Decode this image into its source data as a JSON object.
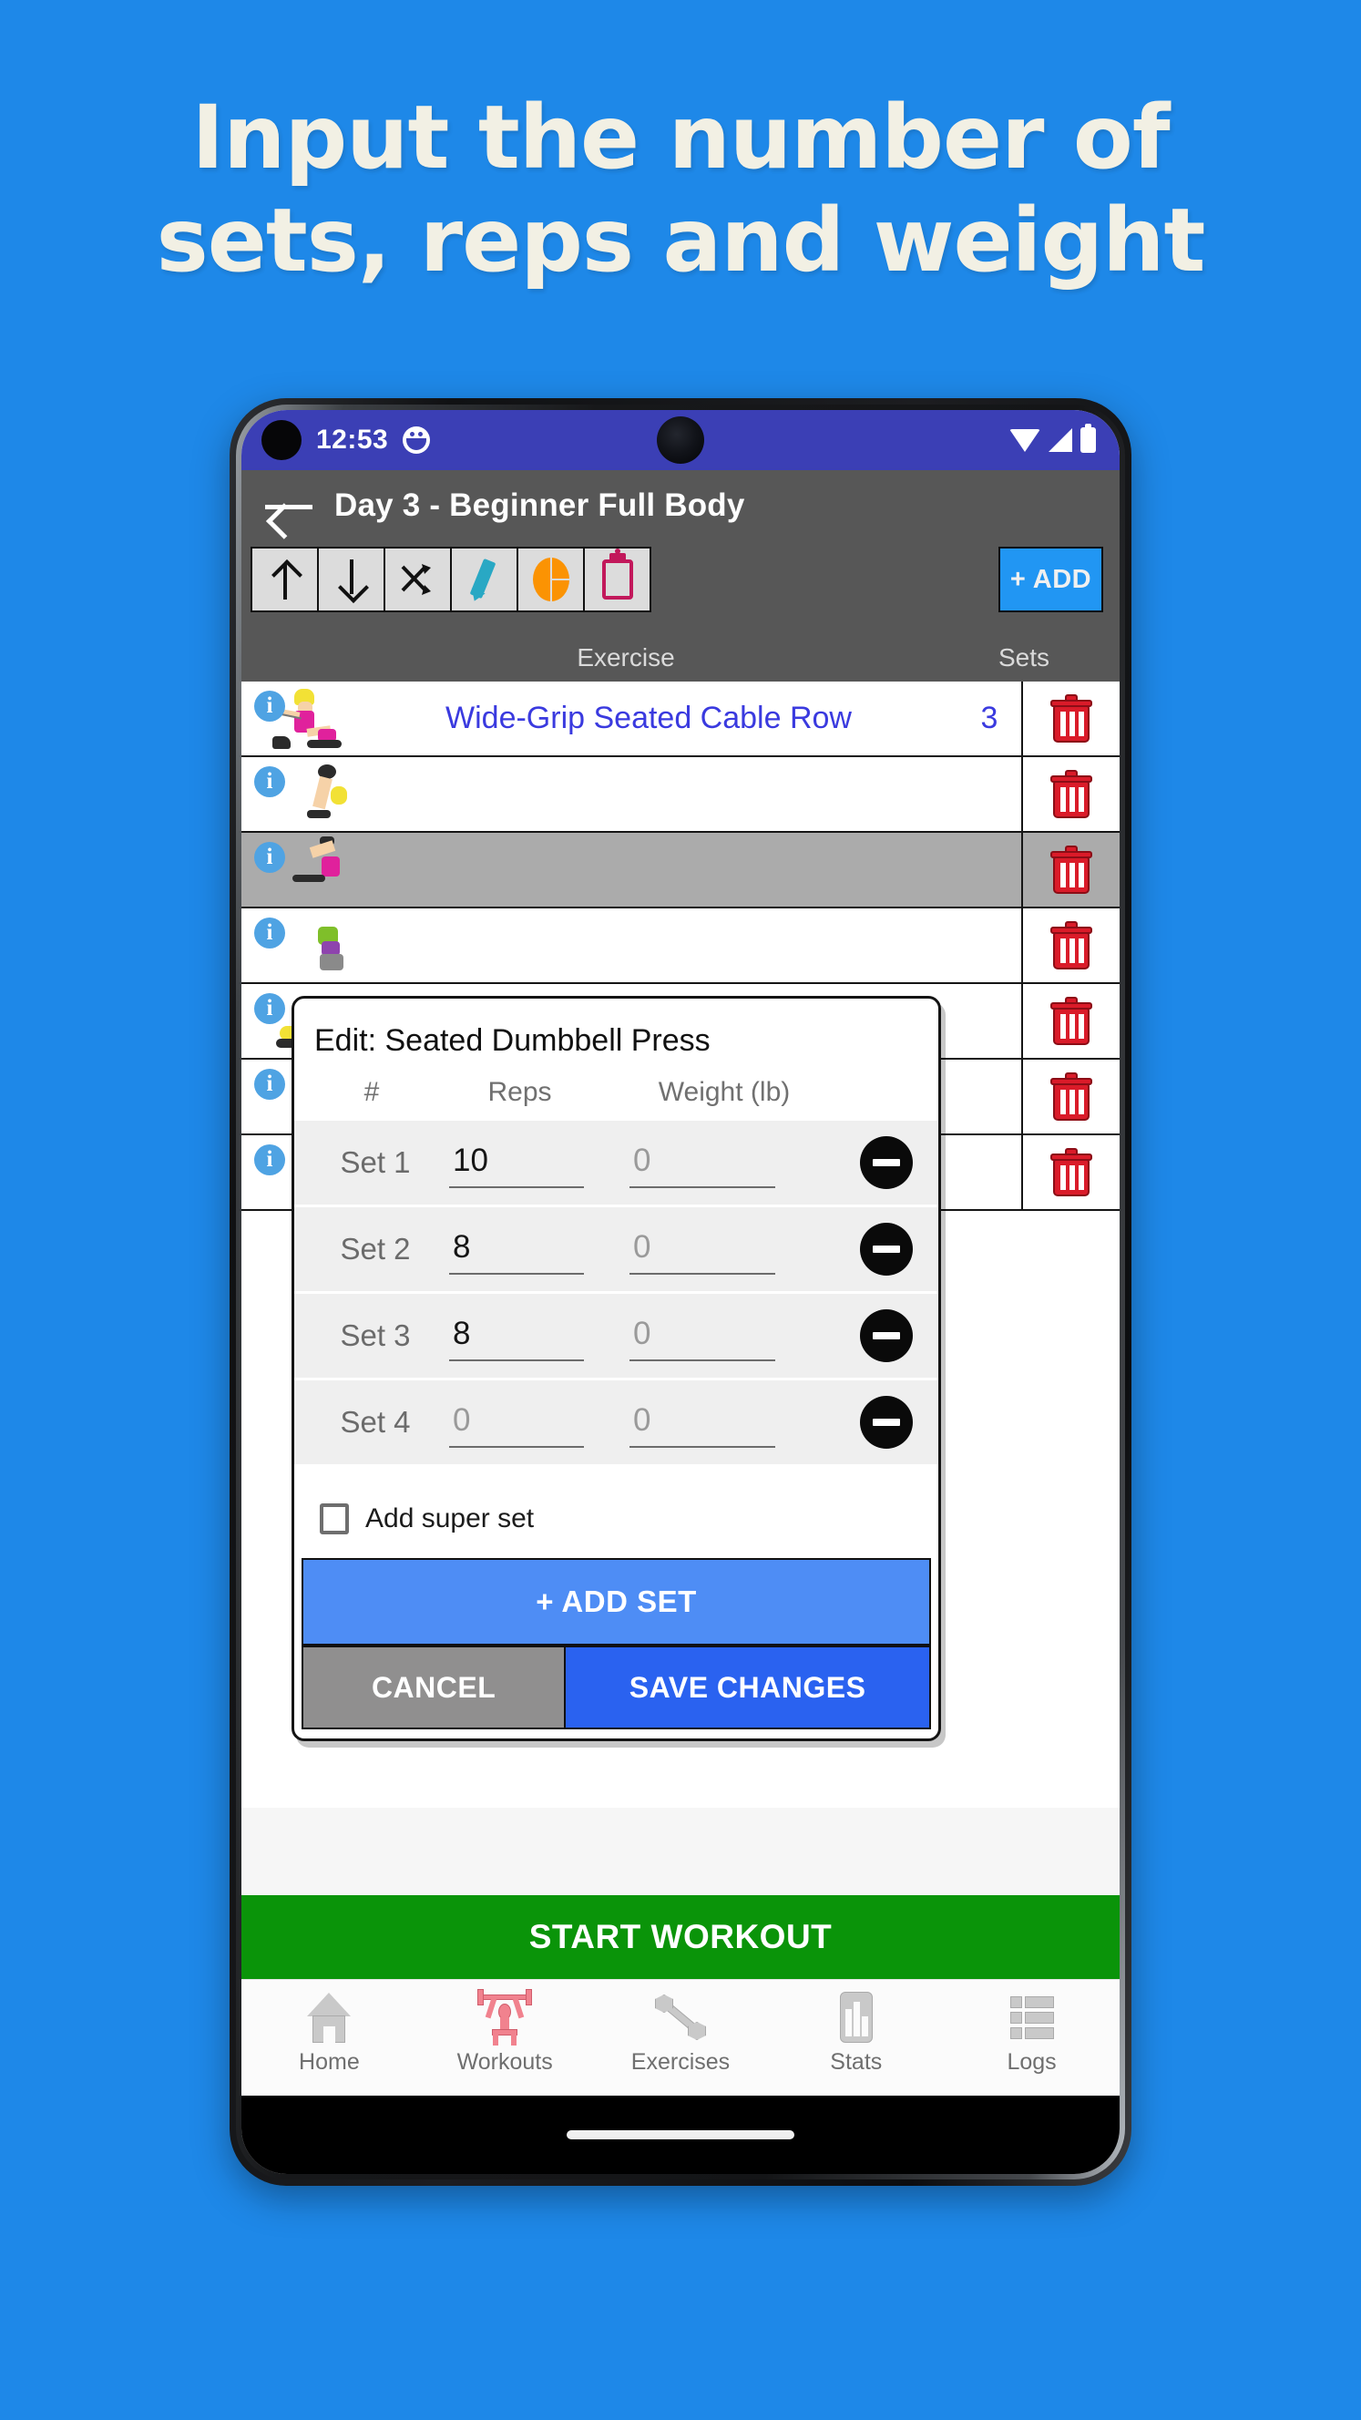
{
  "promo": {
    "line1": "Input the number of",
    "line2": "sets, reps and weight",
    "background_color": "#1E88E8",
    "text_color": "#F2F0E4"
  },
  "status_bar": {
    "time": "12:53",
    "icons": [
      "notification-face-icon",
      "wifi-icon",
      "signal-icon",
      "battery-icon"
    ],
    "background_color": "#3B3FB5"
  },
  "app_bar": {
    "back_label": "back-arrow",
    "title": "Day 3 - Beginner Full Body",
    "background_color": "#575757"
  },
  "toolbar": {
    "buttons": [
      {
        "name": "move-up",
        "icon": "arrow-up-icon"
      },
      {
        "name": "move-down",
        "icon": "arrow-down-icon"
      },
      {
        "name": "shuffle",
        "icon": "shuffle-icon"
      },
      {
        "name": "edit",
        "icon": "pencil-icon",
        "color": "#29A8C4"
      },
      {
        "name": "chart",
        "icon": "pie-chart-icon",
        "color": "#FB9303"
      },
      {
        "name": "notes",
        "icon": "clipboard-icon",
        "color": "#C2185B"
      }
    ],
    "add_label": "+ ADD",
    "add_color": "#2196F3"
  },
  "columns": {
    "exercise": "Exercise",
    "sets": "Sets"
  },
  "exercises": [
    {
      "name": "Wide-Grip Seated Cable Row",
      "sets": "3",
      "selected": false,
      "visible_text": true
    },
    {
      "name": "",
      "sets": "",
      "selected": false,
      "visible_text": false
    },
    {
      "name": "",
      "sets": "",
      "selected": true,
      "visible_text": false
    },
    {
      "name": "",
      "sets": "",
      "selected": false,
      "visible_text": false
    },
    {
      "name": "",
      "sets": "",
      "selected": false,
      "visible_text": false
    },
    {
      "name": "",
      "sets": "",
      "selected": false,
      "visible_text": false
    },
    {
      "name": "",
      "sets": "",
      "selected": false,
      "visible_text": false
    }
  ],
  "dialog": {
    "title": "Edit: Seated Dumbbell Press",
    "columns": {
      "num": "#",
      "reps": "Reps",
      "weight": "Weight (lb)"
    },
    "sets": [
      {
        "label": "Set 1",
        "reps": "10",
        "reps_filled": true,
        "weight": "0",
        "weight_filled": false
      },
      {
        "label": "Set 2",
        "reps": "8",
        "reps_filled": true,
        "weight": "0",
        "weight_filled": false
      },
      {
        "label": "Set 3",
        "reps": "8",
        "reps_filled": true,
        "weight": "0",
        "weight_filled": false
      },
      {
        "label": "Set 4",
        "reps": "0",
        "reps_filled": false,
        "weight": "0",
        "weight_filled": false
      }
    ],
    "superset_label": "Add super set",
    "superset_checked": false,
    "add_set_label": "+ ADD SET",
    "cancel_label": "CANCEL",
    "save_label": "SAVE CHANGES",
    "add_set_color": "#4E8DF5",
    "save_color": "#2A62F0",
    "cancel_color": "#908F8F"
  },
  "start_button": {
    "label": "START WORKOUT",
    "color": "#0A9409"
  },
  "bottom_nav": {
    "items": [
      {
        "label": "Home",
        "icon": "home-icon",
        "active": false
      },
      {
        "label": "Workouts",
        "icon": "weightlifter-icon",
        "active": true
      },
      {
        "label": "Exercises",
        "icon": "dumbbell-icon",
        "active": false
      },
      {
        "label": "Stats",
        "icon": "bar-chart-icon",
        "active": false
      },
      {
        "label": "Logs",
        "icon": "list-icon",
        "active": false
      }
    ],
    "active_color": "#F1828E"
  }
}
